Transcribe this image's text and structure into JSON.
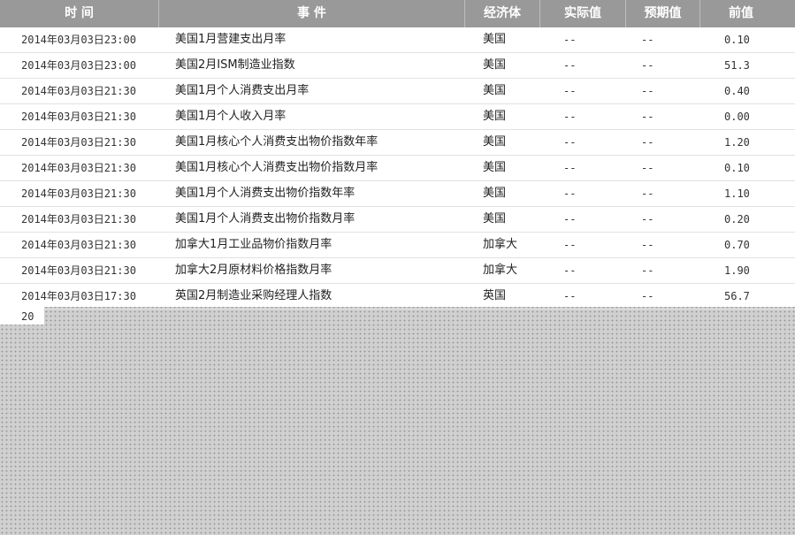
{
  "header": {
    "time": "时 间",
    "event": "事 件",
    "economy": "经济体",
    "actual": "实际值",
    "forecast": "预期值",
    "previous": "前值"
  },
  "rows": [
    {
      "time": "2014年03月03日23:00",
      "event": "美国1月营建支出月率",
      "economy": "美国",
      "actual": "--",
      "forecast": "--",
      "previous": "0.10"
    },
    {
      "time": "2014年03月03日23:00",
      "event": "美国2月ISM制造业指数",
      "economy": "美国",
      "actual": "--",
      "forecast": "--",
      "previous": "51.3"
    },
    {
      "time": "2014年03月03日21:30",
      "event": "美国1月个人消费支出月率",
      "economy": "美国",
      "actual": "--",
      "forecast": "--",
      "previous": "0.40"
    },
    {
      "time": "2014年03月03日21:30",
      "event": "美国1月个人收入月率",
      "economy": "美国",
      "actual": "--",
      "forecast": "--",
      "previous": "0.00"
    },
    {
      "time": "2014年03月03日21:30",
      "event": "美国1月核心个人消费支出物价指数年率",
      "economy": "美国",
      "actual": "--",
      "forecast": "--",
      "previous": "1.20"
    },
    {
      "time": "2014年03月03日21:30",
      "event": "美国1月核心个人消费支出物价指数月率",
      "economy": "美国",
      "actual": "--",
      "forecast": "--",
      "previous": "0.10"
    },
    {
      "time": "2014年03月03日21:30",
      "event": "美国1月个人消费支出物价指数年率",
      "economy": "美国",
      "actual": "--",
      "forecast": "--",
      "previous": "1.10"
    },
    {
      "time": "2014年03月03日21:30",
      "event": "美国1月个人消费支出物价指数月率",
      "economy": "美国",
      "actual": "--",
      "forecast": "--",
      "previous": "0.20"
    },
    {
      "time": "2014年03月03日21:30",
      "event": "加拿大1月工业品物价指数月率",
      "economy": "加拿大",
      "actual": "--",
      "forecast": "--",
      "previous": "0.70"
    },
    {
      "time": "2014年03月03日21:30",
      "event": "加拿大2月原材料价格指数月率",
      "economy": "加拿大",
      "actual": "--",
      "forecast": "--",
      "previous": "1.90"
    },
    {
      "time": "2014年03月03日17:30",
      "event": "英国2月制造业采购经理人指数",
      "economy": "英国",
      "actual": "--",
      "forecast": "--",
      "previous": "56.7"
    }
  ],
  "partial_row_text": "20"
}
